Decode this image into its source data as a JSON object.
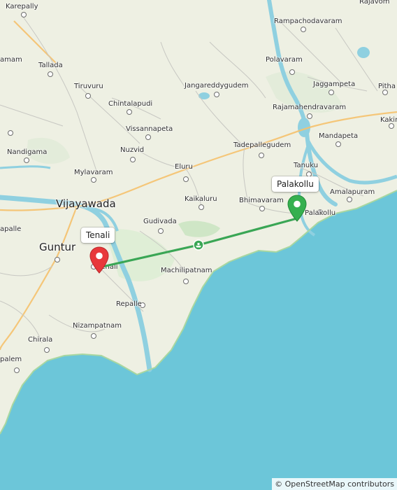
{
  "map": {
    "places": [
      {
        "name": "Karepally"
      },
      {
        "name": "Rajavom"
      },
      {
        "name": "Rampachodavaram"
      },
      {
        "name": "amam"
      },
      {
        "name": "Tallada"
      },
      {
        "name": "Polavaram"
      },
      {
        "name": "Jaggampeta"
      },
      {
        "name": "Pitha"
      },
      {
        "name": "Tiruvuru"
      },
      {
        "name": "Jangareddygudem"
      },
      {
        "name": "Chintalapudi"
      },
      {
        "name": "Rajamahendravaram"
      },
      {
        "name": "Kakin"
      },
      {
        "name": "Vissannapeta"
      },
      {
        "name": "Mandapeta"
      },
      {
        "name": "Nandigama"
      },
      {
        "name": "Nuzvid"
      },
      {
        "name": "Tadepallegudem"
      },
      {
        "name": "Mylavaram"
      },
      {
        "name": "Eluru"
      },
      {
        "name": "Tanuku"
      },
      {
        "name": "Amalapuram"
      },
      {
        "name": "Kaikaluru"
      },
      {
        "name": "Bhimavaram"
      },
      {
        "name": "Palakollu"
      },
      {
        "name": "apalle"
      },
      {
        "name": "Gudivada"
      },
      {
        "name": "Machilipatnam"
      },
      {
        "name": "Repalle"
      },
      {
        "name": "Nizampatnam"
      },
      {
        "name": "Chirala"
      },
      {
        "name": "palem"
      }
    ],
    "cities": [
      {
        "name": "Vijayawada"
      },
      {
        "name": "Guntur"
      }
    ],
    "origin": {
      "label": "Tenali",
      "town": "Tenali"
    },
    "destination": {
      "label": "Palakollu"
    },
    "route_icon": "ferry-icon",
    "attribution": "© OpenStreetMap contributors"
  },
  "colors": {
    "sea": "#6cc6d9",
    "land": "#eef0e3",
    "route": "#3aa655",
    "origin_pin": "#e8383b",
    "destination_pin": "#35b04f"
  }
}
